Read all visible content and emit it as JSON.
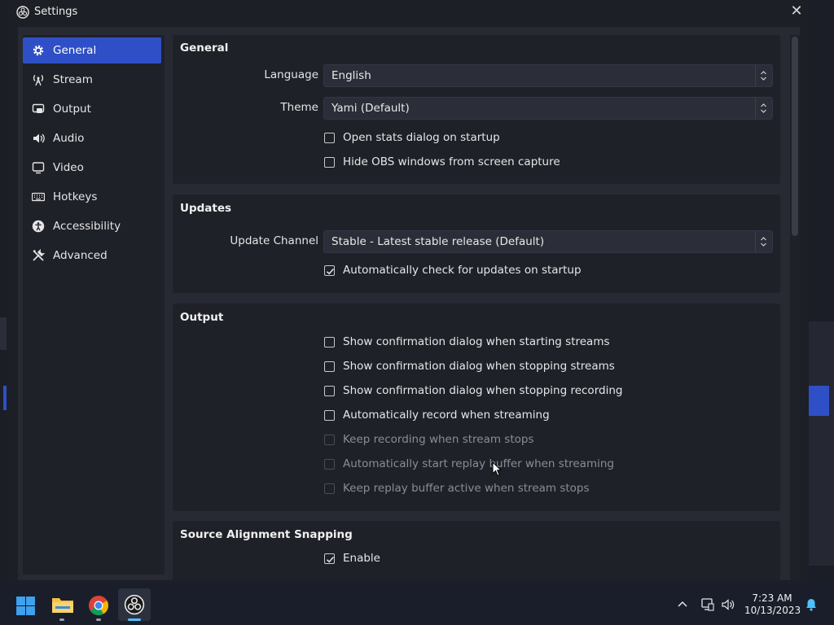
{
  "window": {
    "title": "Settings",
    "close_label": "✕"
  },
  "sidebar": {
    "items": [
      {
        "label": "General",
        "icon": "gear-icon",
        "active": true
      },
      {
        "label": "Stream",
        "icon": "antenna-icon"
      },
      {
        "label": "Output",
        "icon": "output-icon"
      },
      {
        "label": "Audio",
        "icon": "speaker-icon"
      },
      {
        "label": "Video",
        "icon": "monitor-icon"
      },
      {
        "label": "Hotkeys",
        "icon": "keyboard-icon"
      },
      {
        "label": "Accessibility",
        "icon": "accessibility-icon"
      },
      {
        "label": "Advanced",
        "icon": "tools-icon"
      }
    ]
  },
  "general": {
    "title": "General",
    "language_label": "Language",
    "language_value": "English",
    "theme_label": "Theme",
    "theme_value": "Yami (Default)",
    "open_stats": "Open stats dialog on startup",
    "hide_obs": "Hide OBS windows from screen capture"
  },
  "updates": {
    "title": "Updates",
    "channel_label": "Update Channel",
    "channel_value": "Stable - Latest stable release (Default)",
    "auto_check": "Automatically check for updates on startup"
  },
  "output": {
    "title": "Output",
    "confirm_start": "Show confirmation dialog when starting streams",
    "confirm_stop": "Show confirmation dialog when stopping streams",
    "confirm_stop_rec": "Show confirmation dialog when stopping recording",
    "auto_record": "Automatically record when streaming",
    "keep_recording": "Keep recording when stream stops",
    "auto_replay": "Automatically start replay buffer when streaming",
    "keep_replay": "Keep replay buffer active when stream stops"
  },
  "snapping": {
    "title": "Source Alignment Snapping",
    "enable": "Enable"
  },
  "taskbar": {
    "time": "7:23 AM",
    "date": "10/13/2023"
  },
  "colors": {
    "accent": "#2f4fc7",
    "window_bg": "#1d1f26",
    "panel_bg": "#1f2129"
  }
}
